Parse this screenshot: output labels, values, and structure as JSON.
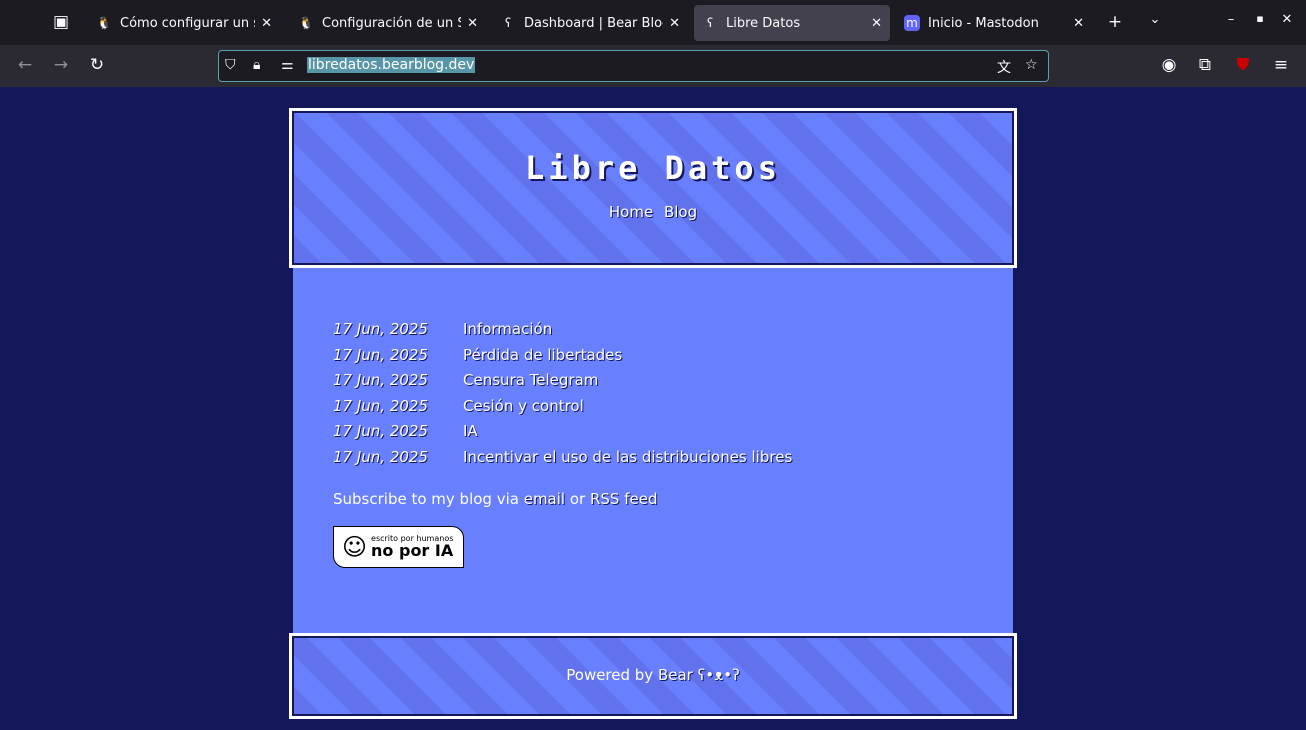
{
  "browser": {
    "tabs": [
      {
        "label": "Cómo configurar un ser",
        "icon": "tux-icon"
      },
      {
        "label": "Configuración de un Se",
        "icon": "tux-icon"
      },
      {
        "label": "Dashboard | Bear Blog",
        "icon": "bear-icon"
      },
      {
        "label": "Libre Datos",
        "icon": "bear-icon",
        "active": true
      },
      {
        "label": "Inicio - Mastodon",
        "icon": "mastodon-icon"
      }
    ],
    "url": "libredatos.bearblog.dev"
  },
  "site": {
    "title": "Libre Datos",
    "nav": [
      "Home",
      "Blog"
    ],
    "posts": [
      {
        "date": "17 Jun, 2025",
        "title": "Información"
      },
      {
        "date": "17 Jun, 2025",
        "title": "Pérdida de libertades"
      },
      {
        "date": "17 Jun, 2025",
        "title": "Censura Telegram"
      },
      {
        "date": "17 Jun, 2025",
        "title": "Cesión y control"
      },
      {
        "date": "17 Jun, 2025",
        "title": "IA"
      },
      {
        "date": "17 Jun, 2025",
        "title": "Incentivar el uso de las distribuciones libres"
      }
    ],
    "subscribe": {
      "prefix": "Subscribe to my blog via ",
      "email": "email",
      "or": " or ",
      "rss": "RSS feed"
    },
    "badge": {
      "line1": "escrito por humanos",
      "line2": "no por IA"
    },
    "footer": {
      "prefix": "Powered by ",
      "link": "Bear ʕ•ᴥ•ʔ"
    }
  }
}
